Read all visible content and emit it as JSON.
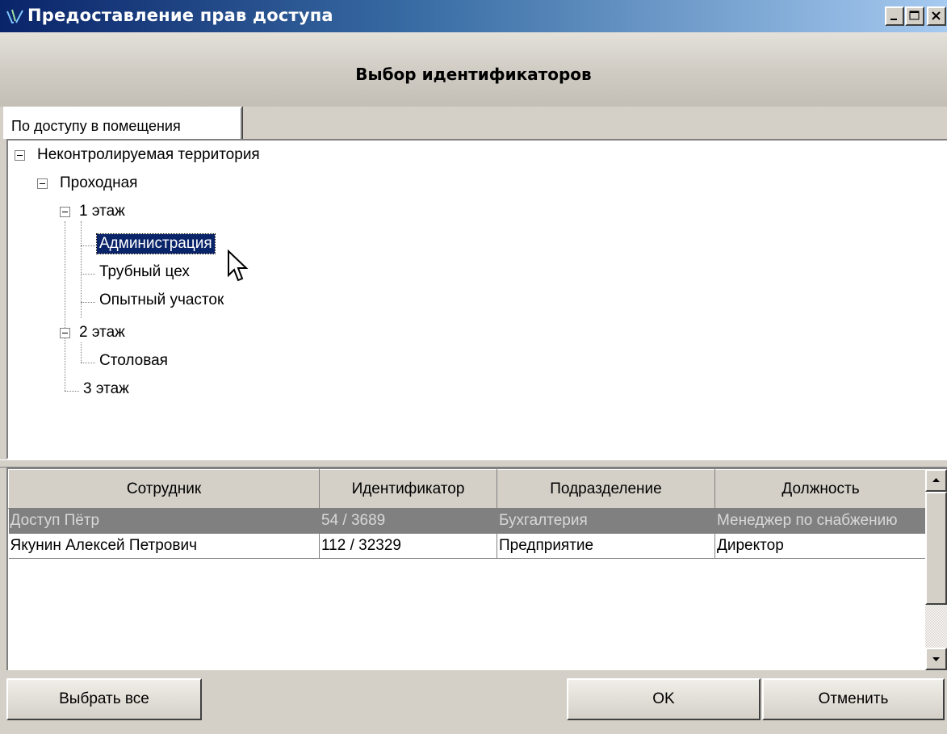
{
  "window": {
    "title": "Предоставление прав доступа"
  },
  "header": {
    "title": "Выбор идентификаторов"
  },
  "tabs": [
    {
      "label": "По доступу в помещения"
    }
  ],
  "tree": {
    "nodes": [
      {
        "label": "Неконтролируемая территория",
        "expanded": true
      },
      {
        "label": "Проходная",
        "expanded": true
      },
      {
        "label": "1 этаж",
        "expanded": true
      },
      {
        "label": "Администрация",
        "selected": true
      },
      {
        "label": "Трубный цех"
      },
      {
        "label": "Опытный участок"
      },
      {
        "label": "2 этаж",
        "expanded": true
      },
      {
        "label": "Столовая"
      },
      {
        "label": "3 этаж"
      }
    ]
  },
  "table": {
    "columns": [
      "Сотрудник",
      "Идентификатор",
      "Подразделение",
      "Должность"
    ],
    "rows": [
      {
        "employee": "Доступ Пётр",
        "identifier": "54 / 3689",
        "department": "Бухгалтерия",
        "position": "Менеджер по снабжению",
        "selected": true
      },
      {
        "employee": "Якунин Алексей Петрович",
        "identifier": "112 / 32329",
        "department": "Предприятие",
        "position": "Директор"
      }
    ]
  },
  "buttons": {
    "select_all": "Выбрать все",
    "ok": "OK",
    "cancel": "Отменить"
  },
  "colors": {
    "titlebar": "#0a246a",
    "selection": "#0a246a",
    "row_selected": "#808080"
  }
}
